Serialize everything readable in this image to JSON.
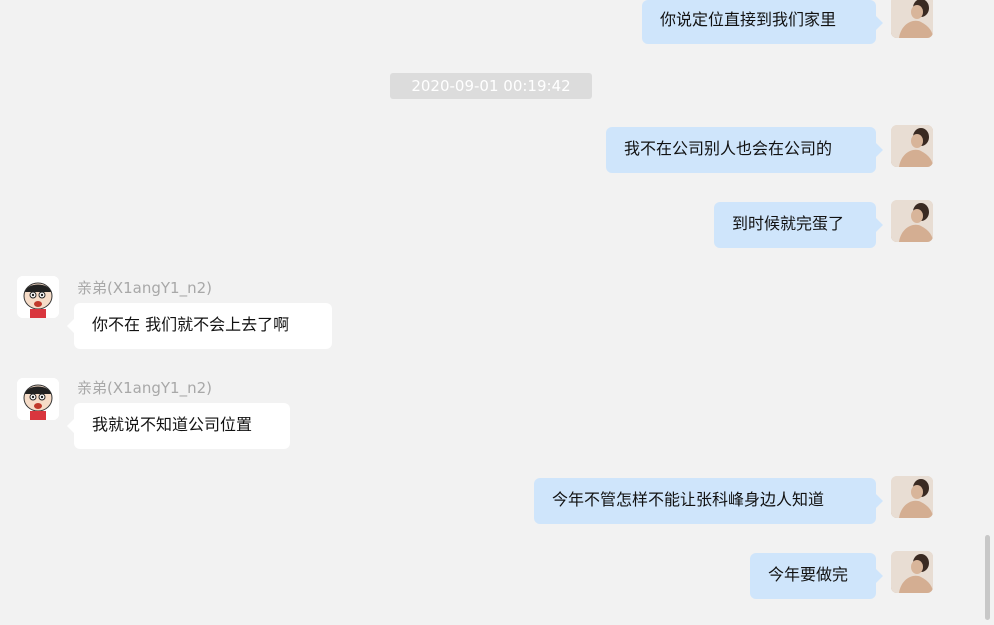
{
  "timestamp": "2020-09-01 00:19:42",
  "friend_name": "亲弟(X1angY1_n2)",
  "messages": [
    {
      "side": "out",
      "text": "你说定位直接到我们家里"
    },
    {
      "side": "out",
      "text": "我不在公司别人也会在公司的"
    },
    {
      "side": "out",
      "text": "到时候就完蛋了"
    },
    {
      "side": "in",
      "text": "你不在 我们就不会上去了啊"
    },
    {
      "side": "in",
      "text": "我就说不知道公司位置"
    },
    {
      "side": "out",
      "text": "今年不管怎样不能让张科峰身边人知道"
    },
    {
      "side": "out",
      "text": "今年要做完"
    }
  ],
  "icons": {
    "self_avatar": "woman-photo-avatar",
    "friend_avatar": "cartoon-boy-avatar"
  },
  "colors": {
    "background": "#f2f2f2",
    "outgoing_bubble": "#cfe5fb",
    "incoming_bubble": "#ffffff",
    "timestamp_bg": "#dcdcdc"
  }
}
